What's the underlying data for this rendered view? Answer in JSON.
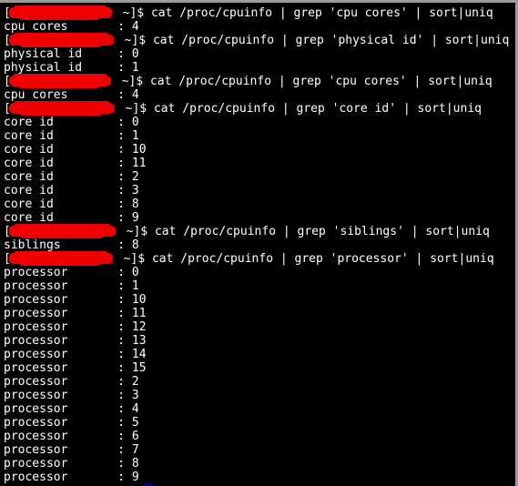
{
  "window": {
    "title": "Terminal",
    "background_color": "#000000",
    "foreground_color": "#ffffff",
    "border_color": "#9a9a9a",
    "cursor_color": "#00008b",
    "redaction_color": "#ee0000"
  },
  "terminal": {
    "prompt_suffix": " ~]$ ",
    "prompt_open_bracket": "[",
    "redaction_note": "username@hostname redacted",
    "lines": [
      {
        "type": "prompt",
        "command": "cat /proc/cpuinfo | grep 'cpu cores' | sort|uniq",
        "redaction_width": 115
      },
      {
        "type": "output",
        "text": "cpu cores       : 4"
      },
      {
        "type": "prompt",
        "command": "cat /proc/cpuinfo | grep 'physical id' | sort|uniq",
        "redaction_width": 117
      },
      {
        "type": "output",
        "text": "physical id     : 0"
      },
      {
        "type": "output",
        "text": "physical id     : 1"
      },
      {
        "type": "prompt",
        "command": "cat /proc/cpuinfo | grep 'cpu cores' | sort|uniq",
        "redaction_width": 114
      },
      {
        "type": "output",
        "text": "cpu cores       : 4"
      },
      {
        "type": "prompt",
        "command": "cat /proc/cpuinfo | grep 'core id' | sort|uniq",
        "redaction_width": 118
      },
      {
        "type": "output",
        "text": "core id         : 0"
      },
      {
        "type": "output",
        "text": "core id         : 1"
      },
      {
        "type": "output",
        "text": "core id         : 10"
      },
      {
        "type": "output",
        "text": "core id         : 11"
      },
      {
        "type": "output",
        "text": "core id         : 2"
      },
      {
        "type": "output",
        "text": "core id         : 3"
      },
      {
        "type": "output",
        "text": "core id         : 8"
      },
      {
        "type": "output",
        "text": "core id         : 9"
      },
      {
        "type": "prompt",
        "command": "cat /proc/cpuinfo | grep 'siblings' | sort|uniq",
        "redaction_width": 119
      },
      {
        "type": "output",
        "text": "siblings        : 8"
      },
      {
        "type": "prompt",
        "command": "cat /proc/cpuinfo | grep 'processor' | sort|uniq",
        "redaction_width": 116
      },
      {
        "type": "output",
        "text": "processor       : 0"
      },
      {
        "type": "output",
        "text": "processor       : 1"
      },
      {
        "type": "output",
        "text": "processor       : 10"
      },
      {
        "type": "output",
        "text": "processor       : 11"
      },
      {
        "type": "output",
        "text": "processor       : 12"
      },
      {
        "type": "output",
        "text": "processor       : 13"
      },
      {
        "type": "output",
        "text": "processor       : 14"
      },
      {
        "type": "output",
        "text": "processor       : 15"
      },
      {
        "type": "output",
        "text": "processor       : 2"
      },
      {
        "type": "output",
        "text": "processor       : 3"
      },
      {
        "type": "output",
        "text": "processor       : 4"
      },
      {
        "type": "output",
        "text": "processor       : 5"
      },
      {
        "type": "output",
        "text": "processor       : 6"
      },
      {
        "type": "output",
        "text": "processor       : 7"
      },
      {
        "type": "output",
        "text": "processor       : 8"
      },
      {
        "type": "output",
        "text": "processor       : 9"
      }
    ]
  }
}
